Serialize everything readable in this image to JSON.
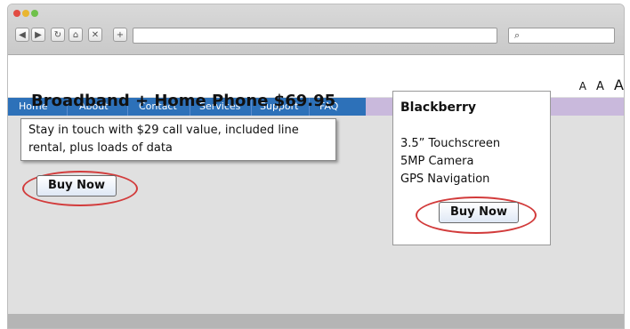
{
  "browser": {
    "nav_icons": [
      "◀",
      "▶",
      "↻",
      "⌂",
      "✕",
      "+"
    ],
    "search_icon": "⌕"
  },
  "page": {
    "font_size_controls": [
      "A",
      "A",
      "A"
    ],
    "nav": [
      "Home",
      "About",
      "Contact",
      "Services",
      "Support",
      "FAQ"
    ],
    "offer": {
      "title": "Broadband + Home Phone $69.95",
      "description": "Stay in touch with $29 call value, included line rental, plus loads of data",
      "buy_label": "Buy Now"
    },
    "product": {
      "name": "Blackberry",
      "features": [
        "3.5” Touchscreen",
        "5MP Camera",
        "GPS Navigation"
      ],
      "buy_label": "Buy Now"
    }
  },
  "colors": {
    "nav_blue": "#2d71b9",
    "nav_lilac": "#c9b9dc",
    "highlight_red": "#d23b3b"
  }
}
